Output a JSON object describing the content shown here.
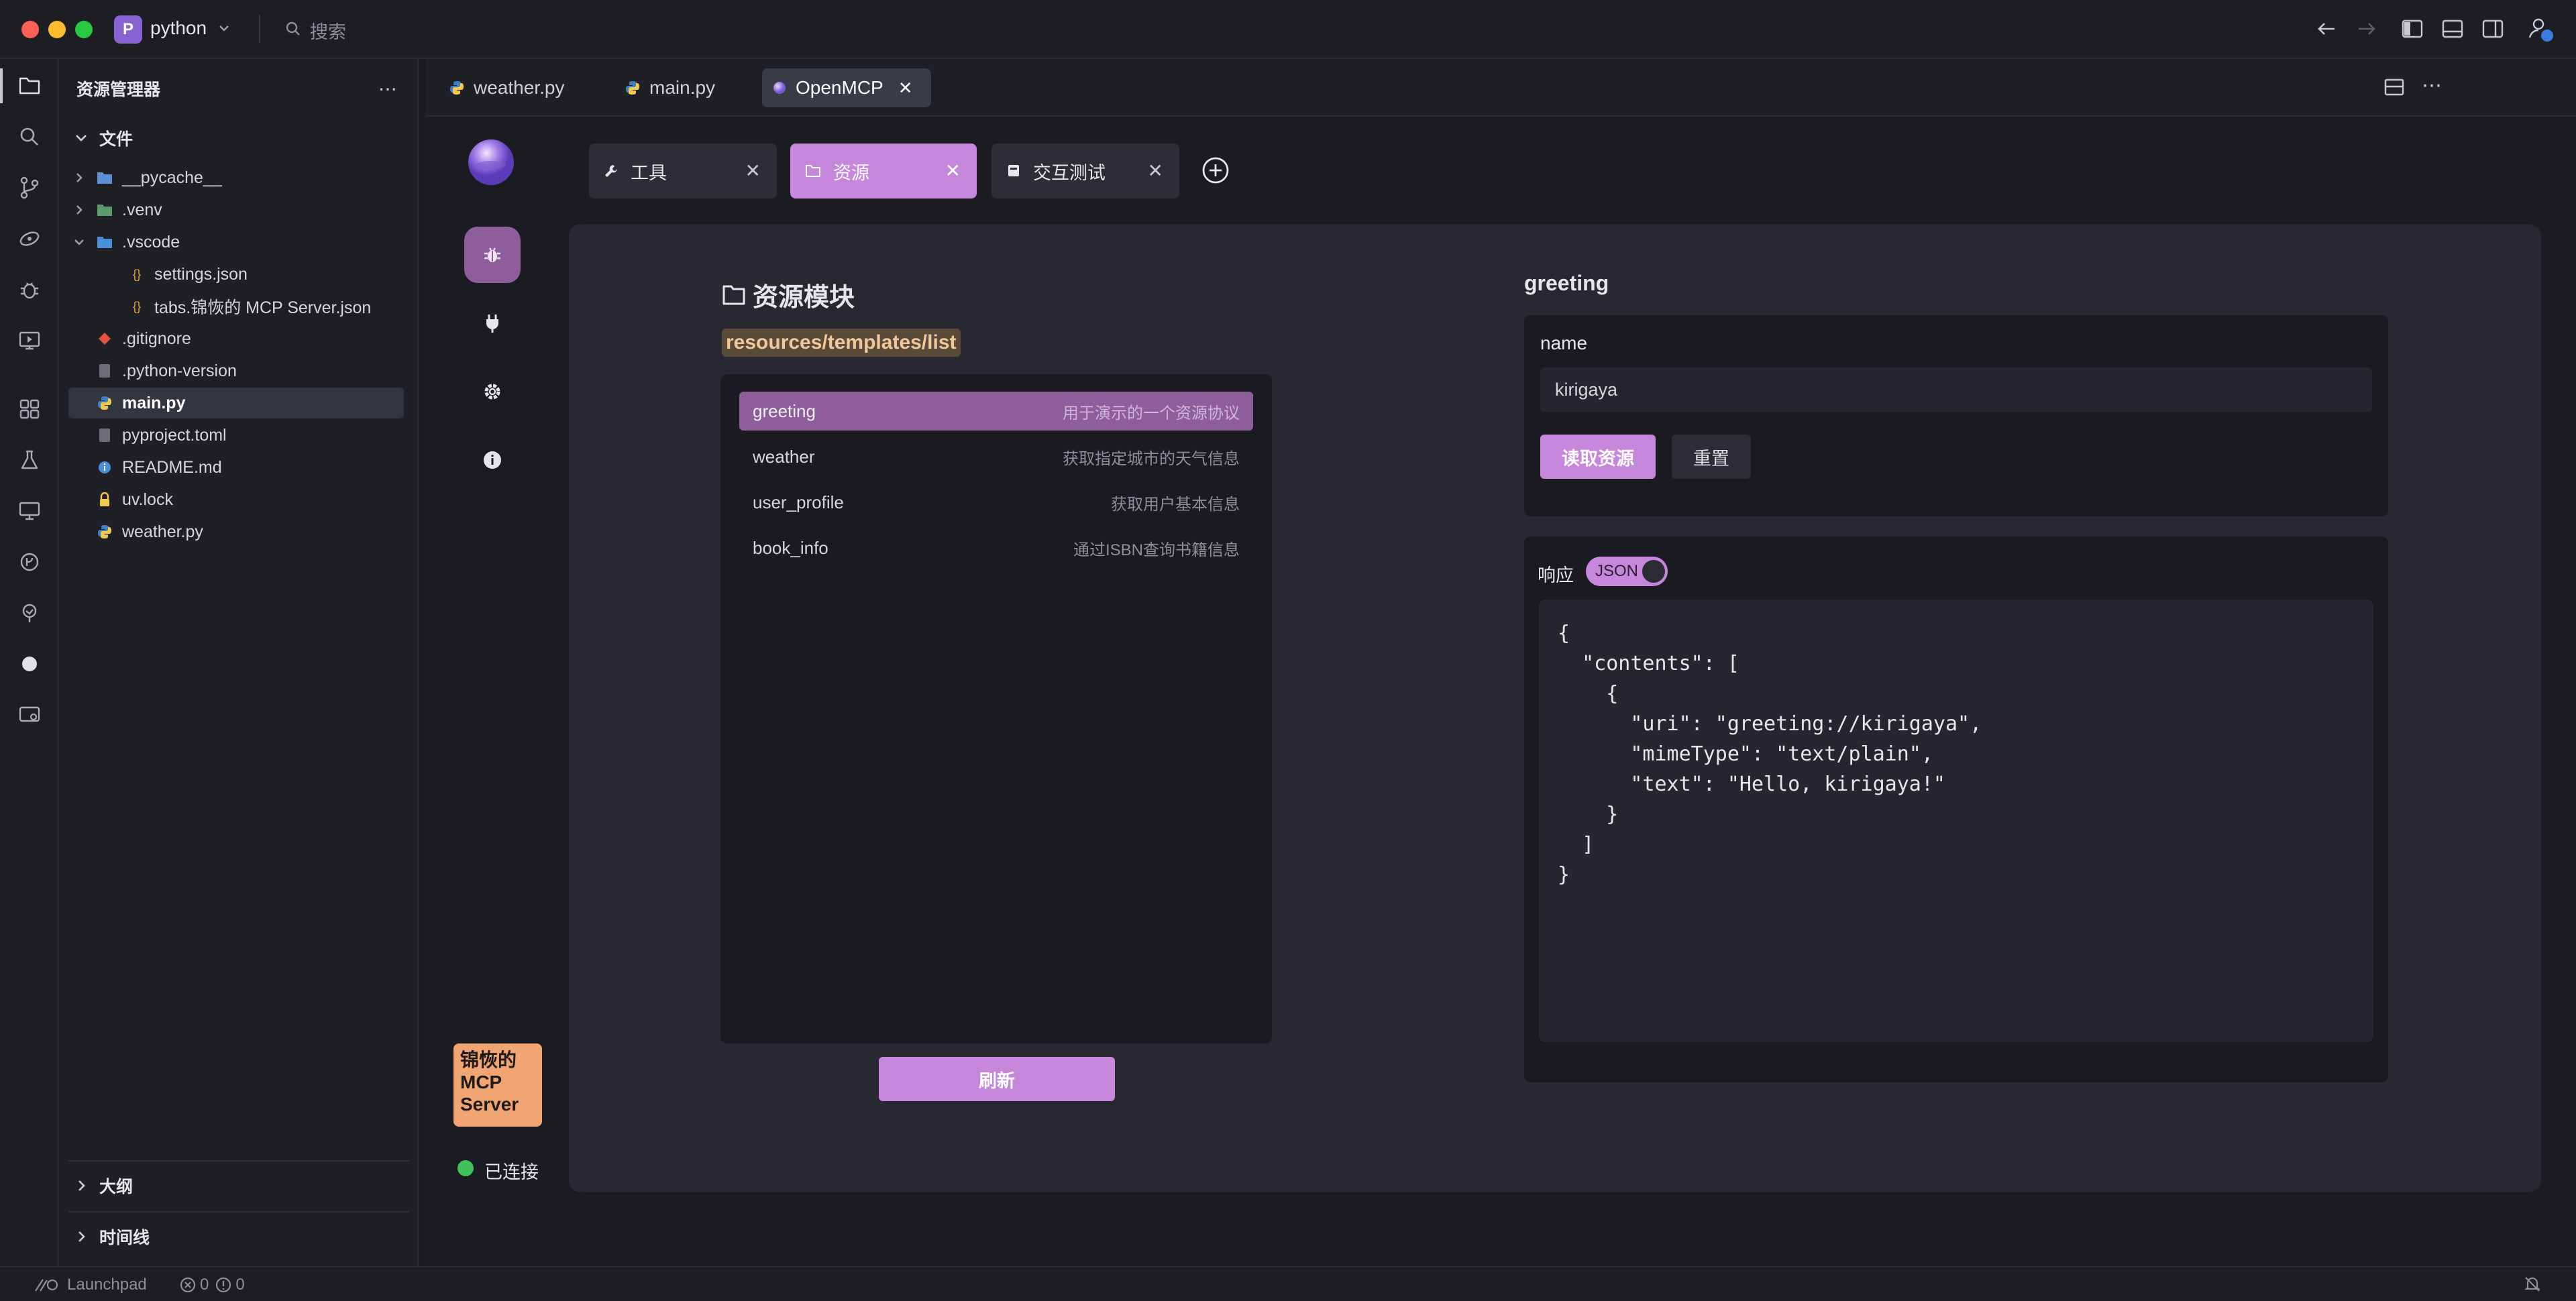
{
  "titlebar": {
    "project_initial": "P",
    "project_name": "python",
    "search_label": "搜索",
    "window_controls": [
      "close",
      "minimize",
      "maximize"
    ]
  },
  "activity_bar": {
    "icons": [
      "files-icon",
      "search-icon",
      "source-control-icon",
      "remote-icon",
      "debug-icon",
      "run-icon",
      "extensions-icon",
      "testing-icon",
      "remote-explorer-icon",
      "github-icon",
      "tree-icon",
      "record-icon",
      "screen-icon"
    ]
  },
  "explorer": {
    "title": "资源管理器",
    "section_files": "文件",
    "items": [
      {
        "label": "__pycache__",
        "type": "folder",
        "icon": "folder-icon"
      },
      {
        "label": ".venv",
        "type": "folder",
        "icon": "folder-icon"
      },
      {
        "label": ".vscode",
        "type": "folder-open",
        "icon": "folder-icon"
      },
      {
        "label": "settings.json",
        "type": "json",
        "icon": "json-icon"
      },
      {
        "label": "tabs.锦恢的 MCP Server.json",
        "type": "json",
        "icon": "json-icon"
      },
      {
        "label": ".gitignore",
        "type": "git",
        "icon": "git-icon"
      },
      {
        "label": ".python-version",
        "type": "file",
        "icon": "file-icon"
      },
      {
        "label": "main.py",
        "type": "python",
        "icon": "python-icon"
      },
      {
        "label": "pyproject.toml",
        "type": "file",
        "icon": "file-icon"
      },
      {
        "label": "README.md",
        "type": "info",
        "icon": "info-icon"
      },
      {
        "label": "uv.lock",
        "type": "lock",
        "icon": "lock-icon"
      },
      {
        "label": "weather.py",
        "type": "python",
        "icon": "python-icon"
      }
    ],
    "section_outline": "大纲",
    "section_timeline": "时间线"
  },
  "editor_tabs": [
    {
      "label": "weather.py",
      "icon": "python-icon"
    },
    {
      "label": "main.py",
      "icon": "python-icon"
    },
    {
      "label": "OpenMCP",
      "icon": "openmcp-icon",
      "close": "✕"
    }
  ],
  "openmcp": {
    "server_badge": "锦恢的 MCP Server",
    "connection_status": "已连接",
    "module_tabs": [
      {
        "label": "工具",
        "icon": "wrench-icon"
      },
      {
        "label": "资源",
        "icon": "folder-icon"
      },
      {
        "label": "交互测试",
        "icon": "chat-icon"
      }
    ],
    "tab_close": "✕",
    "resource_module": {
      "title": "资源模块",
      "endpoint": "resources/templates/list",
      "items": [
        {
          "name": "greeting",
          "desc": "用于演示的一个资源协议"
        },
        {
          "name": "weather",
          "desc": "获取指定城市的天气信息"
        },
        {
          "name": "user_profile",
          "desc": "获取用户基本信息"
        },
        {
          "name": "book_info",
          "desc": "通过ISBN查询书籍信息"
        }
      ],
      "refresh_label": "刷新"
    },
    "detail": {
      "title": "greeting",
      "param_label": "name",
      "param_value": "kirigaya",
      "read_label": "读取资源",
      "reset_label": "重置",
      "response_label": "响应",
      "json_toggle": "JSON",
      "json_enabled": true,
      "response_code": "{\n  \"contents\": [\n    {\n      \"uri\": \"greeting://kirigaya\",\n      \"mimeType\": \"text/plain\",\n      \"text\": \"Hello, kirigaya!\"\n    }\n  ]\n}"
    }
  },
  "statusbar": {
    "launchpad": "Launchpad",
    "errors": "0",
    "warnings": "0"
  },
  "colors": {
    "accent": "#c586dc",
    "selected_row": "#8e5d9c",
    "server_badge": "#f0a572",
    "connected": "#3fc25a"
  }
}
